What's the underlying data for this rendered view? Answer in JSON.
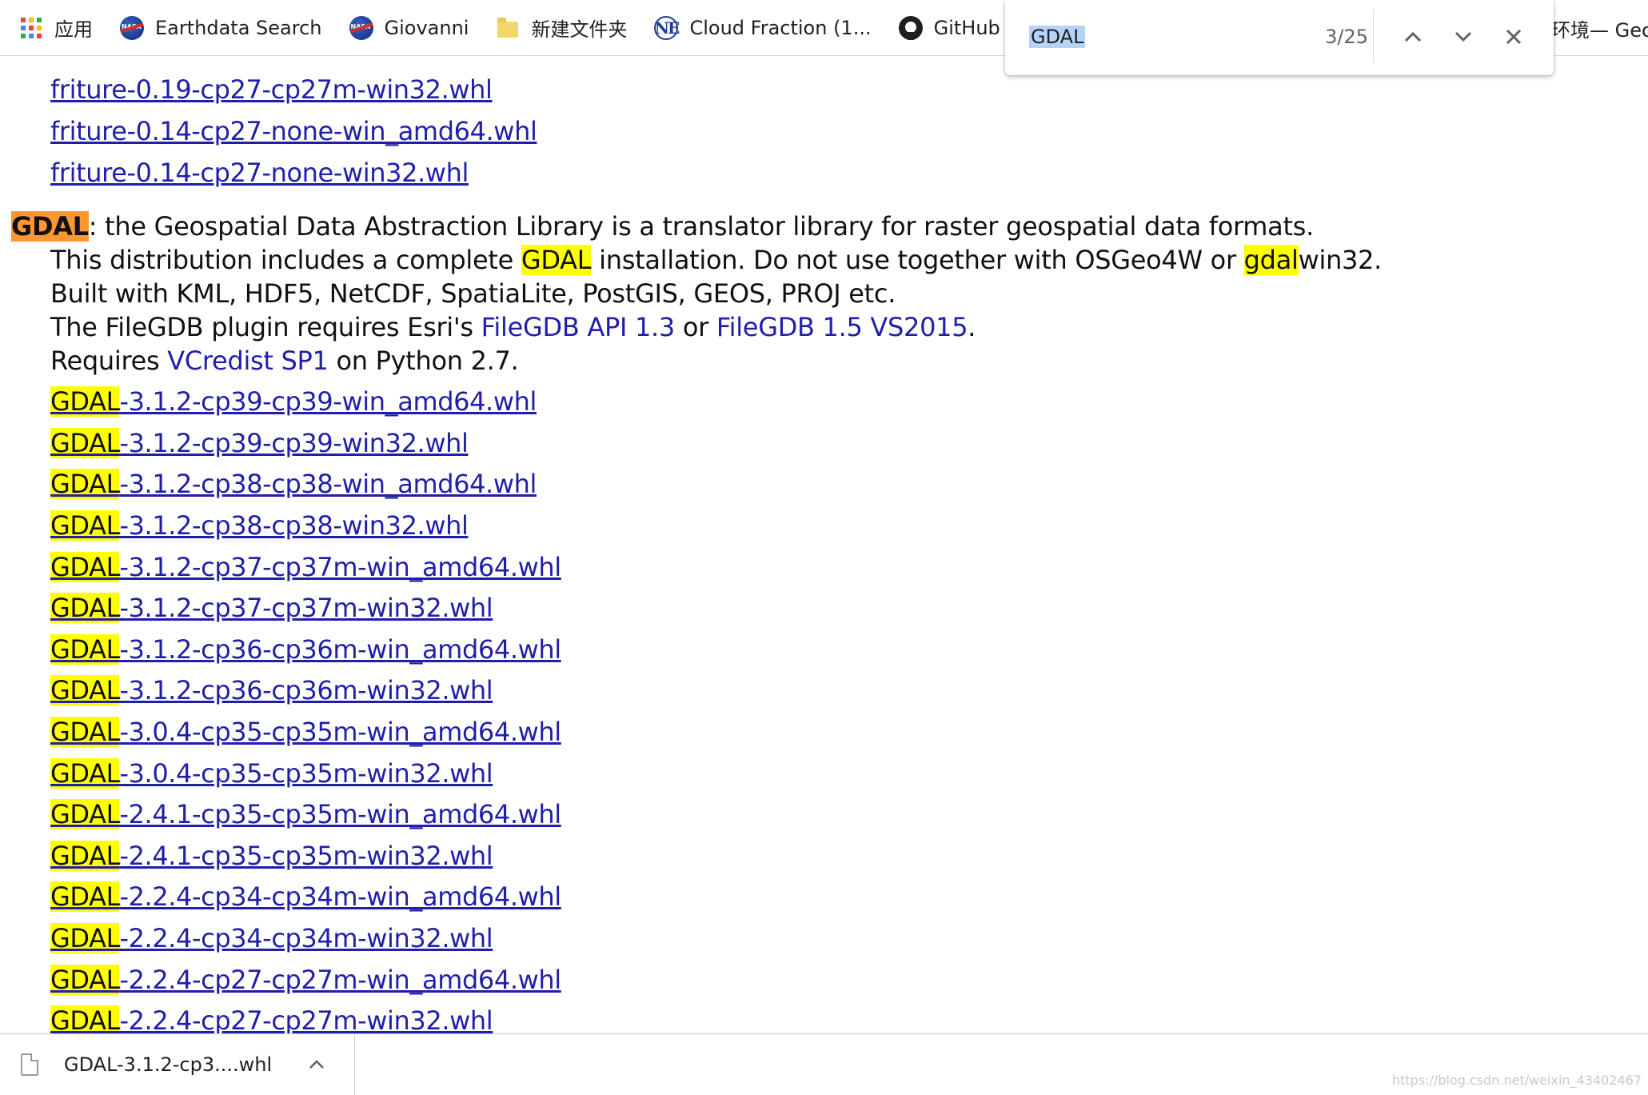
{
  "bookmarks": {
    "apps_label": "应用",
    "items": [
      {
        "label": "Earthdata Search",
        "icon": "nasa-icon"
      },
      {
        "label": "Giovanni",
        "icon": "nasa-icon"
      },
      {
        "label": "新建文件夹",
        "icon": "folder-icon"
      },
      {
        "label": "Cloud Fraction (1...",
        "icon": "ne-icon"
      },
      {
        "label": "GitHub",
        "icon": "github-icon"
      }
    ],
    "overflow_text": "环境— Geo"
  },
  "find_bar": {
    "query": "GDAL",
    "count": "3/25"
  },
  "previous_links": [
    "friture-0.19-cp27-cp27m-win32.whl",
    "friture-0.14-cp27-none-win_amd64.whl",
    "friture-0.14-cp27-none-win32.whl"
  ],
  "gdal_section": {
    "name": "GDAL",
    "line1_rest": ": the Geospatial Data Abstraction Library is a translator library for raster geospatial data formats.",
    "line2_a": "This distribution includes a complete ",
    "line2_hl": "GDAL",
    "line2_b": " installation. Do not use together with OSGeo4W or ",
    "line2_hl2": "gdal",
    "line2_c": "win32.",
    "line3": "Built with KML, HDF5, NetCDF, SpatiaLite, PostGIS, GEOS, PROJ etc.",
    "line4_a": "The FileGDB plugin requires Esri's ",
    "line4_link1": "FileGDB API 1.3",
    "line4_b": " or ",
    "line4_link2": "FileGDB 1.5 VS2015",
    "line4_c": ".",
    "line5_a": "Requires ",
    "line5_link": "VCredist SP1",
    "line5_b": " on Python 2.7.",
    "files": [
      {
        "prefix": "GDAL",
        "rest": "-3.1.2-cp39-cp39-win_amd64.whl"
      },
      {
        "prefix": "GDAL",
        "rest": "-3.1.2-cp39-cp39-win32.whl"
      },
      {
        "prefix": "GDAL",
        "rest": "-3.1.2-cp38-cp38-win_amd64.whl"
      },
      {
        "prefix": "GDAL",
        "rest": "-3.1.2-cp38-cp38-win32.whl"
      },
      {
        "prefix": "GDAL",
        "rest": "-3.1.2-cp37-cp37m-win_amd64.whl"
      },
      {
        "prefix": "GDAL",
        "rest": "-3.1.2-cp37-cp37m-win32.whl"
      },
      {
        "prefix": "GDAL",
        "rest": "-3.1.2-cp36-cp36m-win_amd64.whl"
      },
      {
        "prefix": "GDAL",
        "rest": "-3.1.2-cp36-cp36m-win32.whl"
      },
      {
        "prefix": "GDAL",
        "rest": "-3.0.4-cp35-cp35m-win_amd64.whl"
      },
      {
        "prefix": "GDAL",
        "rest": "-3.0.4-cp35-cp35m-win32.whl"
      },
      {
        "prefix": "GDAL",
        "rest": "-2.4.1-cp35-cp35m-win_amd64.whl"
      },
      {
        "prefix": "GDAL",
        "rest": "-2.4.1-cp35-cp35m-win32.whl"
      },
      {
        "prefix": "GDAL",
        "rest": "-2.2.4-cp34-cp34m-win_amd64.whl"
      },
      {
        "prefix": "GDAL",
        "rest": "-2.2.4-cp34-cp34m-win32.whl"
      },
      {
        "prefix": "GDAL",
        "rest": "-2.2.4-cp27-cp27m-win_amd64.whl"
      },
      {
        "prefix": "GDAL",
        "rest": "-2.2.4-cp27-cp27m-win32.whl"
      }
    ]
  },
  "download_shelf": {
    "file_name": "GDAL-3.1.2-cp3....whl",
    "watermark": "https://blog.csdn.net/weixin_43402467"
  },
  "colors": {
    "link": "#1f1faa",
    "highlight": "#ffff00",
    "active_highlight": "#ff9632",
    "find_selection": "#b5d3f7"
  }
}
